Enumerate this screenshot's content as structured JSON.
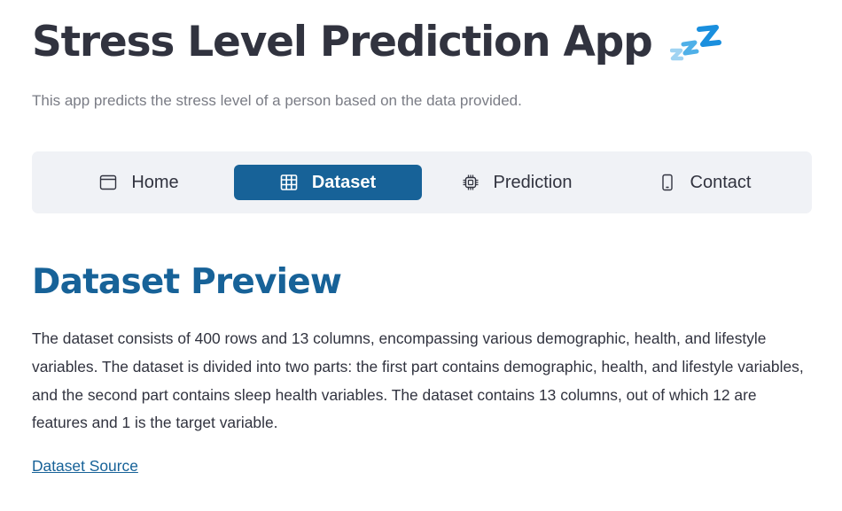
{
  "header": {
    "title": "Stress Level Prediction App",
    "title_emoji_icon": "zzz-sleep-icon",
    "subtitle": "This app predicts the stress level of a person based on the data provided."
  },
  "nav": {
    "active_color": "#176298",
    "background_color": "#f0f2f6",
    "items": [
      {
        "label": "Home",
        "icon": "window-icon",
        "active": false
      },
      {
        "label": "Dataset",
        "icon": "table-icon",
        "active": true
      },
      {
        "label": "Prediction",
        "icon": "cpu-icon",
        "active": false
      },
      {
        "label": "Contact",
        "icon": "phone-icon",
        "active": false
      }
    ]
  },
  "main": {
    "heading": "Dataset Preview",
    "heading_color": "#176298",
    "description": "The dataset consists of 400 rows and 13 columns, encompassing various demographic, health, and lifestyle variables. The dataset is divided into two parts: the first part contains demographic, health, and lifestyle variables, and the second part contains sleep health variables. The dataset contains 13 columns, out of which 12 are features and 1 is the target variable.",
    "source_link": "Dataset Source"
  }
}
